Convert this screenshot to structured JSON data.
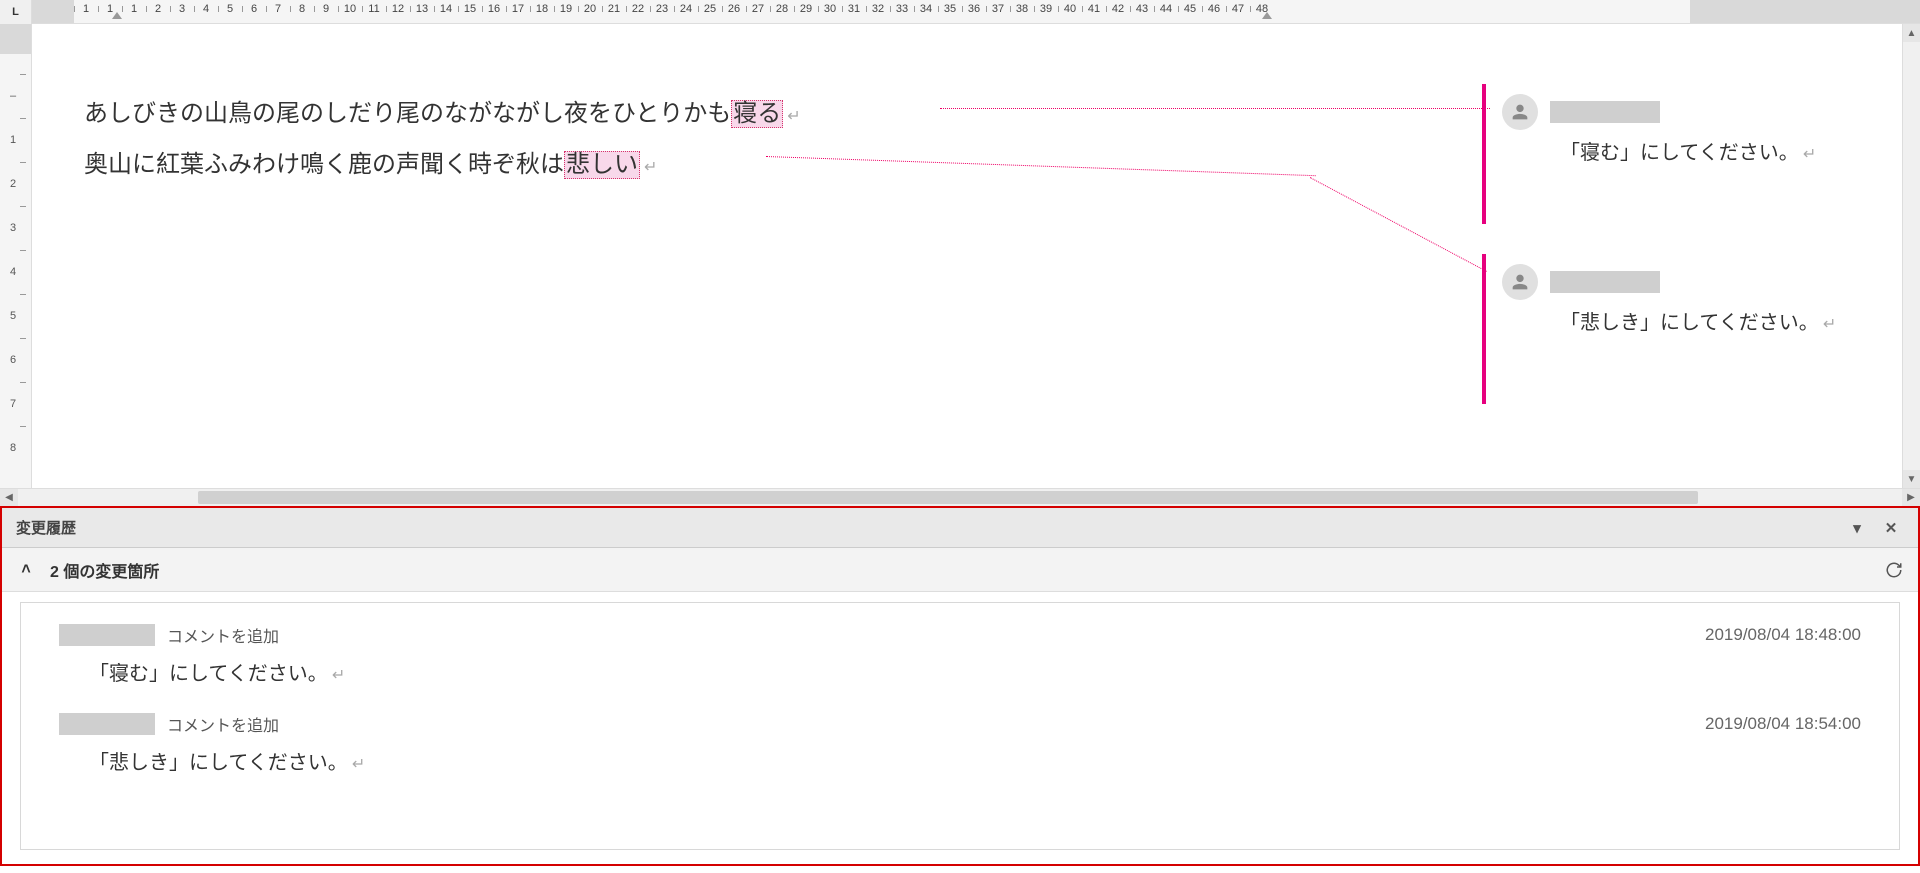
{
  "ruler": {
    "tabCorner": "L",
    "ticks": [
      1,
      1,
      1,
      2,
      3,
      4,
      5,
      6,
      7,
      8,
      9,
      10,
      11,
      12,
      13,
      14,
      15,
      16,
      17,
      18,
      19,
      20,
      21,
      22,
      23,
      24,
      25,
      26,
      27,
      28,
      29,
      30,
      31,
      32,
      33,
      34,
      35,
      36,
      37,
      38,
      39,
      40,
      41,
      42,
      43,
      44,
      45,
      46,
      47,
      48
    ],
    "vticks": [
      "–",
      "1",
      "2",
      "3",
      "4",
      "5",
      "6",
      "7",
      "8"
    ]
  },
  "document": {
    "line1": {
      "before": "あしびきの山鳥の尾のしだり尾のながながし夜をひとりかも",
      "highlight": "寝る",
      "after": ""
    },
    "line2": {
      "before": "奥山に紅葉ふみわけ鳴く鹿の声聞く時ぞ秋は",
      "highlight": "悲しい",
      "after": ""
    },
    "paragraphMark": "↵"
  },
  "comments": [
    {
      "text": "「寝む」にしてください。",
      "mark": "↵"
    },
    {
      "text": "「悲しき」にしてください。",
      "mark": "↵"
    }
  ],
  "reviewPane": {
    "title": "変更履歴",
    "summary": "2 個の変更箇所",
    "items": [
      {
        "action": "コメントを追加",
        "timestamp": "2019/08/04 18:48:00",
        "body": "「寝む」にしてください。",
        "mark": "↵"
      },
      {
        "action": "コメントを追加",
        "timestamp": "2019/08/04 18:54:00",
        "body": "「悲しき」にしてください。",
        "mark": "↵"
      }
    ]
  }
}
